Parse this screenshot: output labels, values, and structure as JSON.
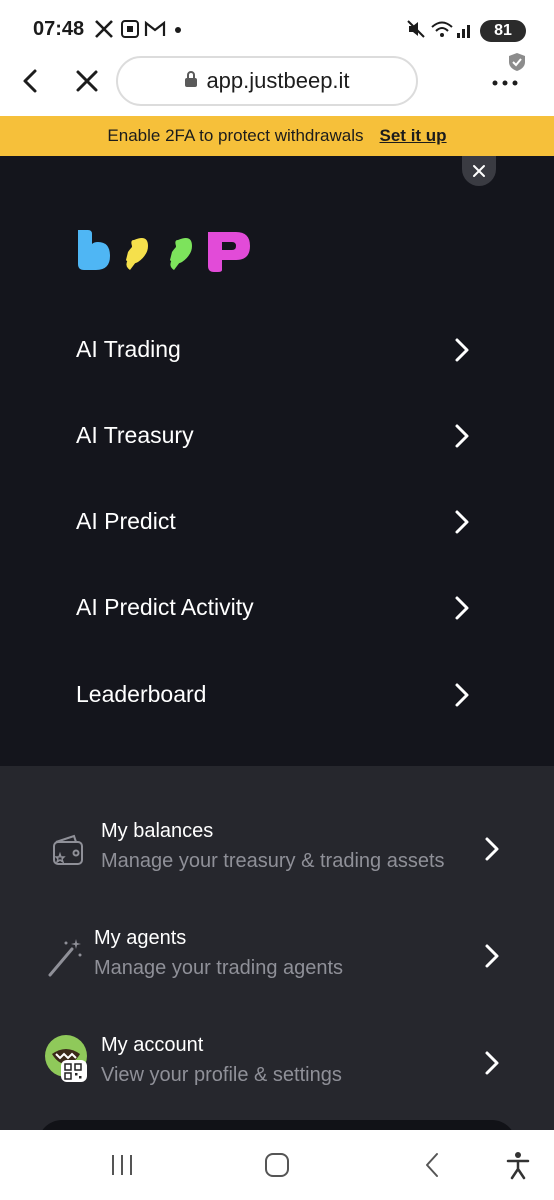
{
  "status_bar": {
    "time": "07:48",
    "battery": "81",
    "left_icons": [
      "x-app-icon",
      "screenshot-icon",
      "gmail-icon",
      "dot-icon"
    ],
    "right_icons": [
      "mute-icon",
      "wifi-icon",
      "signal-icon"
    ]
  },
  "browser": {
    "url": "app.justbeep.it",
    "back_icon": "back-arrow-icon",
    "close_icon": "close-icon",
    "menu_icon": "more-icon"
  },
  "banner": {
    "text": "Enable 2FA to protect withdrawals",
    "link": "Set it up",
    "color": "#f6c03a"
  },
  "logo": {
    "text": "beep",
    "colors": [
      "#4fb6f4",
      "#f5e04c",
      "#7de35c",
      "#e24bd8"
    ]
  },
  "nav": {
    "items": [
      {
        "label": "AI Trading"
      },
      {
        "label": "AI Treasury"
      },
      {
        "label": "AI Predict"
      },
      {
        "label": "AI Predict Activity"
      },
      {
        "label": "Leaderboard"
      }
    ]
  },
  "account": {
    "items": [
      {
        "title": "My balances",
        "subtitle": "Manage your treasury & trading assets",
        "icon": "wallet-icon"
      },
      {
        "title": "My agents",
        "subtitle": "Manage your trading agents",
        "icon": "magic-wand-icon"
      },
      {
        "title": "My account",
        "subtitle": "View your profile & settings",
        "icon": "avatar-icon"
      }
    ]
  },
  "colors": {
    "menu_bg": "#14151c",
    "account_bg": "#26272d",
    "subtitle": "#8f9098"
  }
}
